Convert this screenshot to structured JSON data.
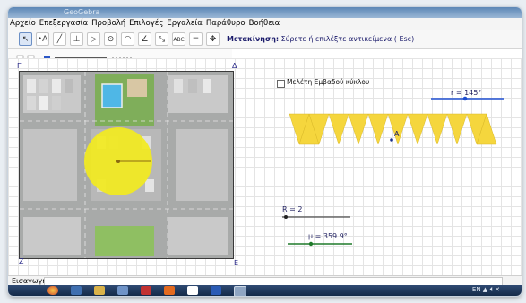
{
  "menu": [
    "Αρχείο",
    "Επεξεργασία",
    "Προβολή",
    "Επιλογές",
    "Εργαλεία",
    "Παράθυρο",
    "Βοήθεια"
  ],
  "toolbar": {
    "mode_label": "Μετακίνηση:",
    "mode_hint": "Σύρετε ή επιλέξτε αντικείμενα ( Esc)",
    "tools": [
      {
        "name": "move",
        "glyph": "↖"
      },
      {
        "name": "point",
        "glyph": "•A"
      },
      {
        "name": "line",
        "glyph": "╱"
      },
      {
        "name": "perpendicular",
        "glyph": "⊥"
      },
      {
        "name": "polygon",
        "glyph": "▷"
      },
      {
        "name": "circle",
        "glyph": "⊙"
      },
      {
        "name": "arc",
        "glyph": "◠"
      },
      {
        "name": "angle",
        "glyph": "∠"
      },
      {
        "name": "reflect",
        "glyph": "⤡"
      },
      {
        "name": "text",
        "glyph": "ABC"
      },
      {
        "name": "slider",
        "glyph": "═"
      },
      {
        "name": "move-view",
        "glyph": "✥"
      }
    ]
  },
  "graphics": {
    "corner_labels": {
      "gamma": "Γ",
      "delta": "Δ",
      "zeta": "Z",
      "epsilon": "E"
    },
    "checkbox_label": "Μελέτη Εμβαδού κύκλου",
    "slider_r": "r = 145°",
    "point_a": "A",
    "slider_R": "R = 2",
    "slider_mu": "μ = 359.9°"
  },
  "inputbar": {
    "label": "Εισαγωγή:"
  },
  "taskbar": {
    "clock": "EN  ▲  ⏴  ✕"
  },
  "colors": {
    "circle": "#f2ea1e",
    "triangles": "#f5d63d",
    "slider_r": "#1e4fd1",
    "slider_mu": "#1f7a2a",
    "slider_R": "#222222"
  }
}
